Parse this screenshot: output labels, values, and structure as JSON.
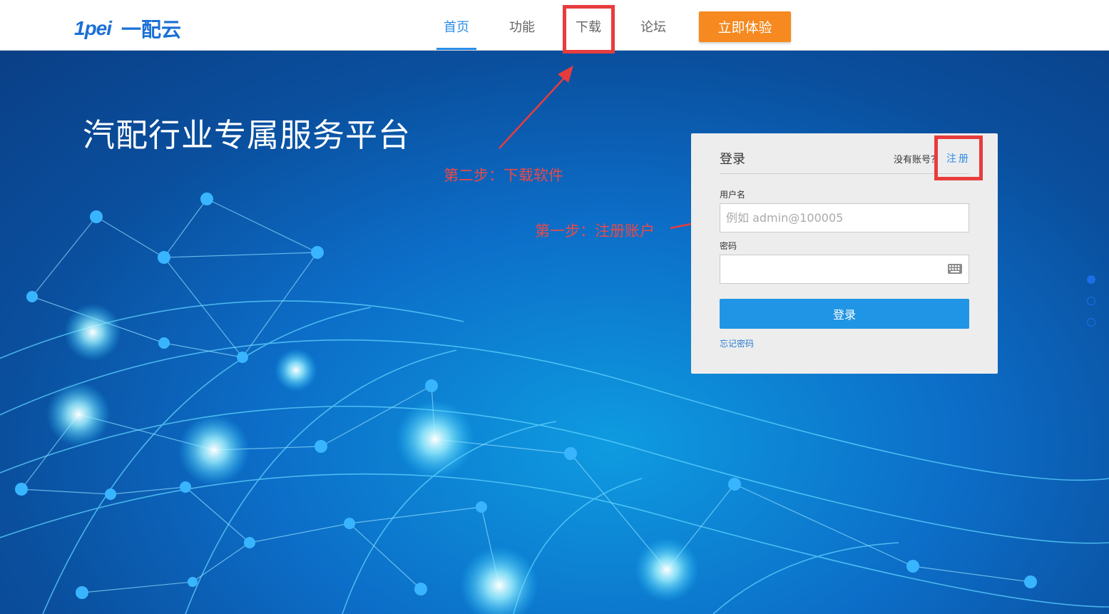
{
  "header": {
    "logo_mark": "1pei",
    "logo_name": "一配云",
    "nav": [
      {
        "label": "首页",
        "active": true
      },
      {
        "label": "功能",
        "active": false
      },
      {
        "label": "下载",
        "active": false
      },
      {
        "label": "论坛",
        "active": false
      }
    ],
    "cta_label": "立即体验"
  },
  "hero": {
    "title": "汽配行业专属服务平台"
  },
  "annotations": {
    "step_two": "第二步：下载软件",
    "step_one": "第一步：注册账户"
  },
  "login": {
    "title": "登录",
    "no_account": "没有账号？",
    "register": "注册",
    "username_label": "用户名",
    "username_placeholder": "例如 admin@100005",
    "password_label": "密码",
    "password_value": "",
    "submit_label": "登录",
    "forgot_label": "忘记密码",
    "keyboard_icon": "keyboard-icon"
  },
  "pager": {
    "slides": 3,
    "active_index": 0
  },
  "colors": {
    "accent": "#2b8de8",
    "cta": "#f6891f",
    "annotation": "#e83c3c",
    "login_button": "#2095e5"
  }
}
